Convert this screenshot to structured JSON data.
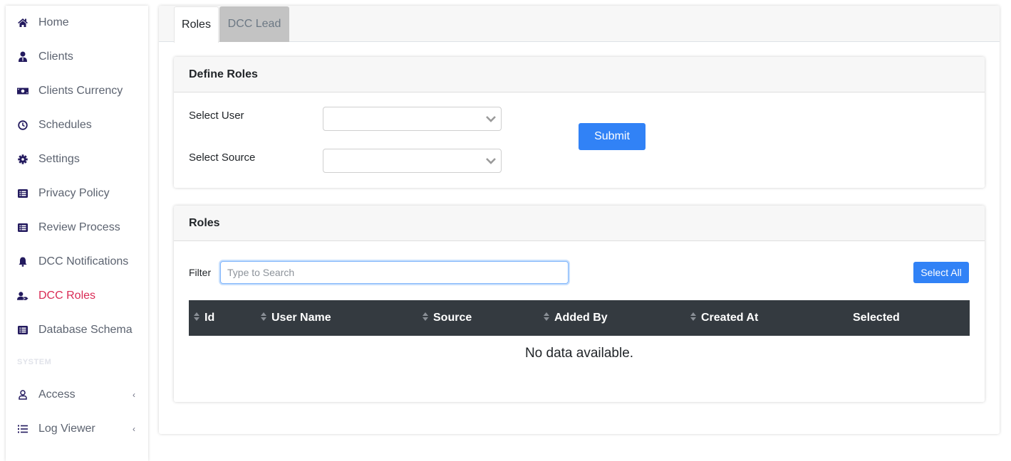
{
  "sidebar": {
    "items": [
      {
        "label": "Home",
        "icon": "home-icon"
      },
      {
        "label": "Clients",
        "icon": "user-tie-icon"
      },
      {
        "label": "Clients Currency",
        "icon": "money-bill-icon"
      },
      {
        "label": "Schedules",
        "icon": "clock-icon"
      },
      {
        "label": "Settings",
        "icon": "gear-icon"
      },
      {
        "label": "Privacy Policy",
        "icon": "list-alt-icon"
      },
      {
        "label": "Review Process",
        "icon": "list-alt-icon"
      },
      {
        "label": "DCC Notifications",
        "icon": "bell-icon"
      },
      {
        "label": "DCC Roles",
        "icon": "user-tag-icon",
        "active": true
      },
      {
        "label": "Database Schema",
        "icon": "list-alt-icon"
      }
    ],
    "section_label": "SYSTEM",
    "system_items": [
      {
        "label": "Access",
        "icon": "user-icon",
        "chevron": "‹"
      },
      {
        "label": "Log Viewer",
        "icon": "list-icon",
        "chevron": "‹"
      }
    ],
    "active_color": "#d92b55",
    "icon_color": "#231a5e"
  },
  "tabs": [
    {
      "label": "Roles",
      "active": true
    },
    {
      "label": "DCC Lead",
      "active": false
    }
  ],
  "define_roles": {
    "title": "Define Roles",
    "select_user_label": "Select User",
    "select_user_value": "",
    "select_source_label": "Select Source",
    "select_source_value": "",
    "submit_label": "Submit"
  },
  "roles": {
    "title": "Roles",
    "filter_label": "Filter",
    "filter_placeholder": "Type to Search",
    "filter_value": "",
    "select_all_label": "Select All",
    "columns": [
      {
        "label": "Id",
        "sortable": true
      },
      {
        "label": "User Name",
        "sortable": true
      },
      {
        "label": "Source",
        "sortable": true
      },
      {
        "label": "Added By",
        "sortable": true
      },
      {
        "label": "Created At",
        "sortable": true
      },
      {
        "label": "Selected",
        "sortable": false
      }
    ],
    "rows": [],
    "empty_text": "No data available."
  },
  "colors": {
    "primary": "#3182f6",
    "table_header": "#343a40"
  }
}
